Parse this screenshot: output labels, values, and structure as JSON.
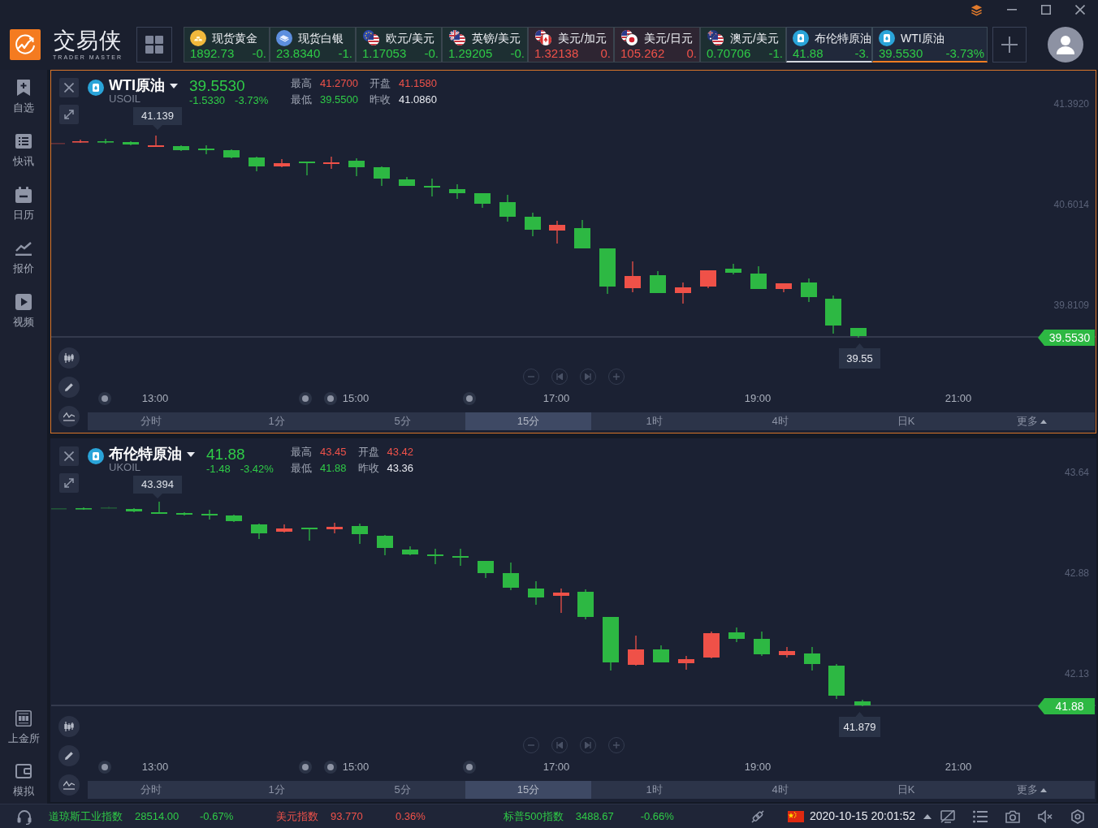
{
  "app": {
    "logo_title": "交易侠",
    "logo_subtitle": "TRADER MASTER"
  },
  "tickers": [
    {
      "kind": "gold",
      "name": "现货黄金",
      "price": "1892.73",
      "change": "-0.",
      "color": "#2fcb47",
      "in_chart": false,
      "selected": false
    },
    {
      "kind": "silver",
      "name": "现货白银",
      "price": "23.8340",
      "change": "-1.",
      "color": "#2fcb47",
      "in_chart": false,
      "selected": false
    },
    {
      "kind": "eu-us",
      "name": "欧元/美元",
      "price": "1.17053",
      "change": "-0.",
      "color": "#2fcb47",
      "in_chart": false,
      "selected": false
    },
    {
      "kind": "gb-us",
      "name": "英镑/美元",
      "price": "1.29205",
      "change": "-0.",
      "color": "#2fcb47",
      "in_chart": false,
      "selected": false
    },
    {
      "kind": "us-ca",
      "name": "美元/加元",
      "price": "1.32138",
      "change": "0.",
      "color": "#f0524a",
      "in_chart": false,
      "selected": false
    },
    {
      "kind": "us-jp",
      "name": "美元/日元",
      "price": "105.262",
      "change": "0.",
      "color": "#f0524a",
      "in_chart": false,
      "selected": false
    },
    {
      "kind": "au-us",
      "name": "澳元/美元",
      "price": "0.70706",
      "change": "-1.",
      "color": "#2fcb47",
      "in_chart": false,
      "selected": false
    },
    {
      "kind": "oil",
      "name": "布伦特原油",
      "price": "41.88",
      "change": "-3.",
      "color": "#2fcb47",
      "in_chart": true,
      "selected": false
    },
    {
      "kind": "oil",
      "name": "WTI原油",
      "price": "39.5530",
      "change": "-3.73%",
      "color": "#2fcb47",
      "in_chart": true,
      "selected": true
    }
  ],
  "sidebar": {
    "items": [
      {
        "kind": "watchlist",
        "label": "自选"
      },
      {
        "kind": "news",
        "label": "快讯"
      },
      {
        "kind": "calendar",
        "label": "日历"
      },
      {
        "kind": "quotes",
        "label": "报价"
      },
      {
        "kind": "video",
        "label": "视频"
      }
    ],
    "bottom_items": [
      {
        "kind": "exchange",
        "label": "上金所"
      },
      {
        "kind": "demo",
        "label": "模拟"
      }
    ]
  },
  "charts": [
    {
      "selected": true,
      "name": "WTI原油",
      "symbol": "USOIL",
      "price": "39.5530",
      "change": "-1.5330",
      "change_percent": "-3.73%",
      "color": "#2fcb47",
      "stats": [
        {
          "label": "最高",
          "value": "41.2700",
          "color": "#f0524a"
        },
        {
          "label": "开盘",
          "value": "41.1580",
          "color": "#f0524a"
        },
        {
          "label": "最低",
          "value": "39.5500",
          "color": "#2fcb47"
        },
        {
          "label": "昨收",
          "value": "41.0860",
          "color": "#e8eaf0"
        }
      ],
      "high_marker": "41.139",
      "y_axis": [
        "41.3920",
        "40.6014",
        "39.8109"
      ],
      "last_price_tag": "39.5530",
      "last_candle_label": "39.55",
      "x_axis": [
        "13:00",
        "15:00",
        "17:00",
        "19:00",
        "21:00"
      ],
      "timeframes": [
        {
          "label": "分时",
          "selected": false
        },
        {
          "label": "1分",
          "selected": false
        },
        {
          "label": "5分",
          "selected": false
        },
        {
          "label": "15分",
          "selected": true
        },
        {
          "label": "1时",
          "selected": false
        },
        {
          "label": "4时",
          "selected": false
        },
        {
          "label": "日K",
          "selected": false
        },
        {
          "label": "更多",
          "selected": false
        }
      ]
    },
    {
      "selected": false,
      "name": "布伦特原油",
      "symbol": "UKOIL",
      "price": "41.88",
      "change": "-1.48",
      "change_percent": "-3.42%",
      "color": "#2fcb47",
      "stats": [
        {
          "label": "最高",
          "value": "43.45",
          "color": "#f0524a"
        },
        {
          "label": "开盘",
          "value": "43.42",
          "color": "#f0524a"
        },
        {
          "label": "最低",
          "value": "41.88",
          "color": "#2fcb47"
        },
        {
          "label": "昨收",
          "value": "43.36",
          "color": "#e8eaf0"
        }
      ],
      "high_marker": "43.394",
      "y_axis": [
        "43.64",
        "42.88",
        "42.13"
      ],
      "last_price_tag": "41.88",
      "last_candle_label": "41.879",
      "x_axis": [
        "13:00",
        "15:00",
        "17:00",
        "19:00",
        "21:00"
      ],
      "timeframes": [
        {
          "label": "分时",
          "selected": false
        },
        {
          "label": "1分",
          "selected": false
        },
        {
          "label": "5分",
          "selected": false
        },
        {
          "label": "15分",
          "selected": true
        },
        {
          "label": "1时",
          "selected": false
        },
        {
          "label": "4时",
          "selected": false
        },
        {
          "label": "日K",
          "selected": false
        },
        {
          "label": "更多",
          "selected": false
        }
      ]
    }
  ],
  "status_bar": {
    "indices": [
      {
        "name": "道琼斯工业指数",
        "value": "28514.00",
        "change": "-0.67%",
        "color": "#2fcb47"
      },
      {
        "name": "美元指数",
        "value": "93.770",
        "change": "0.36%",
        "color": "#f0524a"
      },
      {
        "name": "标普500指数",
        "value": "3488.67",
        "change": "-0.66%",
        "color": "#2fcb47"
      }
    ],
    "datetime": "2020-10-15 20:01:52"
  }
}
